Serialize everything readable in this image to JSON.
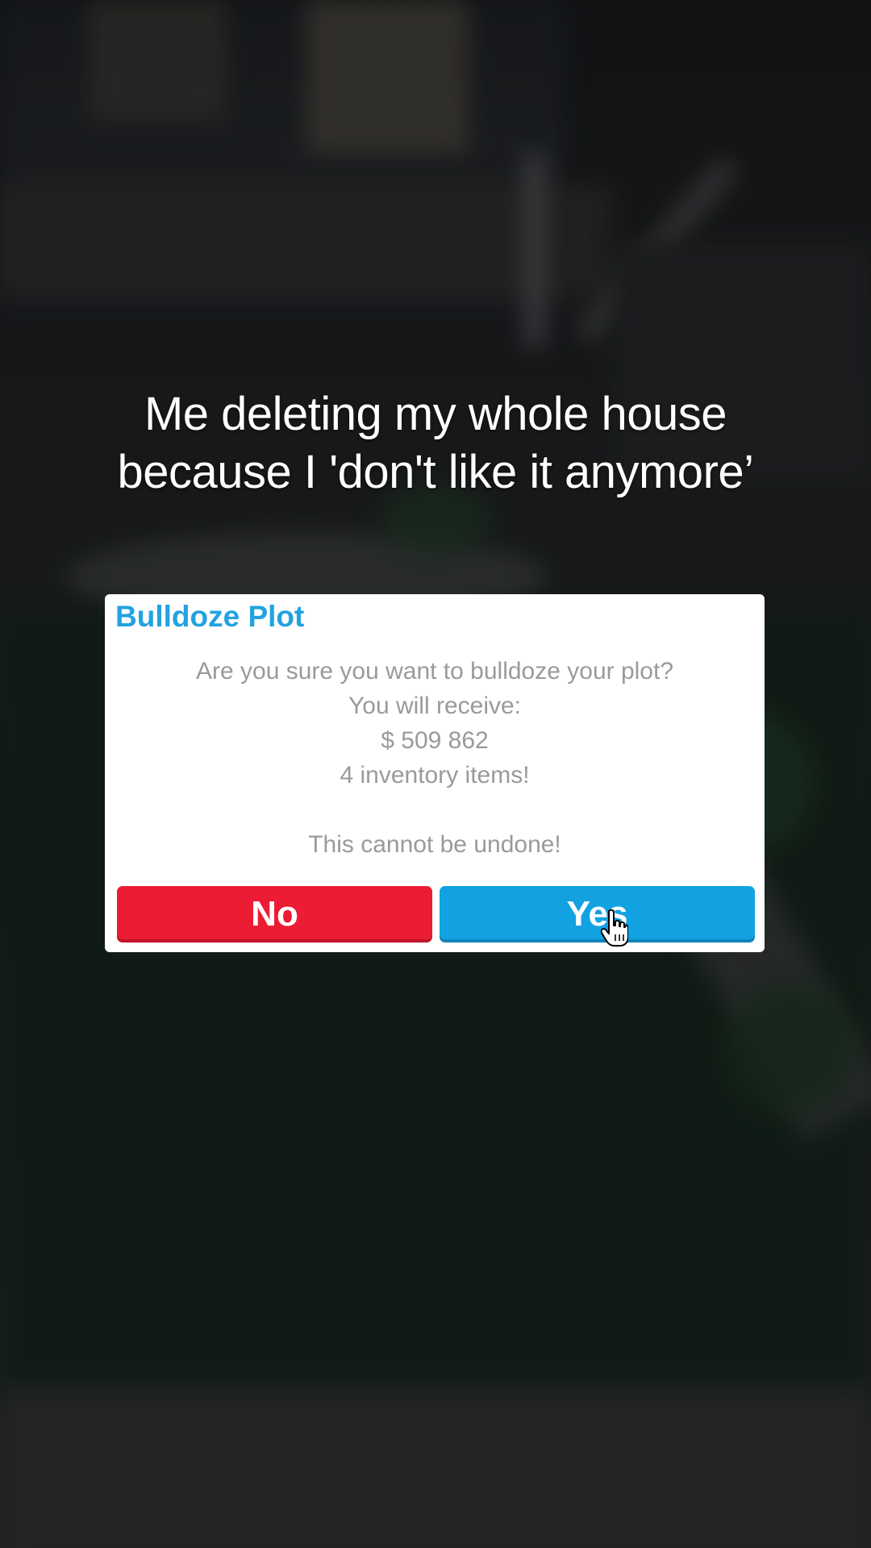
{
  "caption": {
    "line1": "Me deleting my whole house",
    "line2": "because I 'don't like it anymore’"
  },
  "dialog": {
    "title": "Bulldoze Plot",
    "question": "Are you sure you want to bulldoze your plot?",
    "receive_label": "You will receive:",
    "money": "$ 509 862",
    "items": "4 inventory items!",
    "warning": "This cannot be undone!",
    "no_label": "No",
    "yes_label": "Yes"
  },
  "colors": {
    "title": "#22a3e0",
    "no_button": "#ec1c34",
    "yes_button": "#12a2e2",
    "body_text": "#9a9a9a"
  },
  "icons": {
    "cursor": "hand-pointer-icon"
  }
}
